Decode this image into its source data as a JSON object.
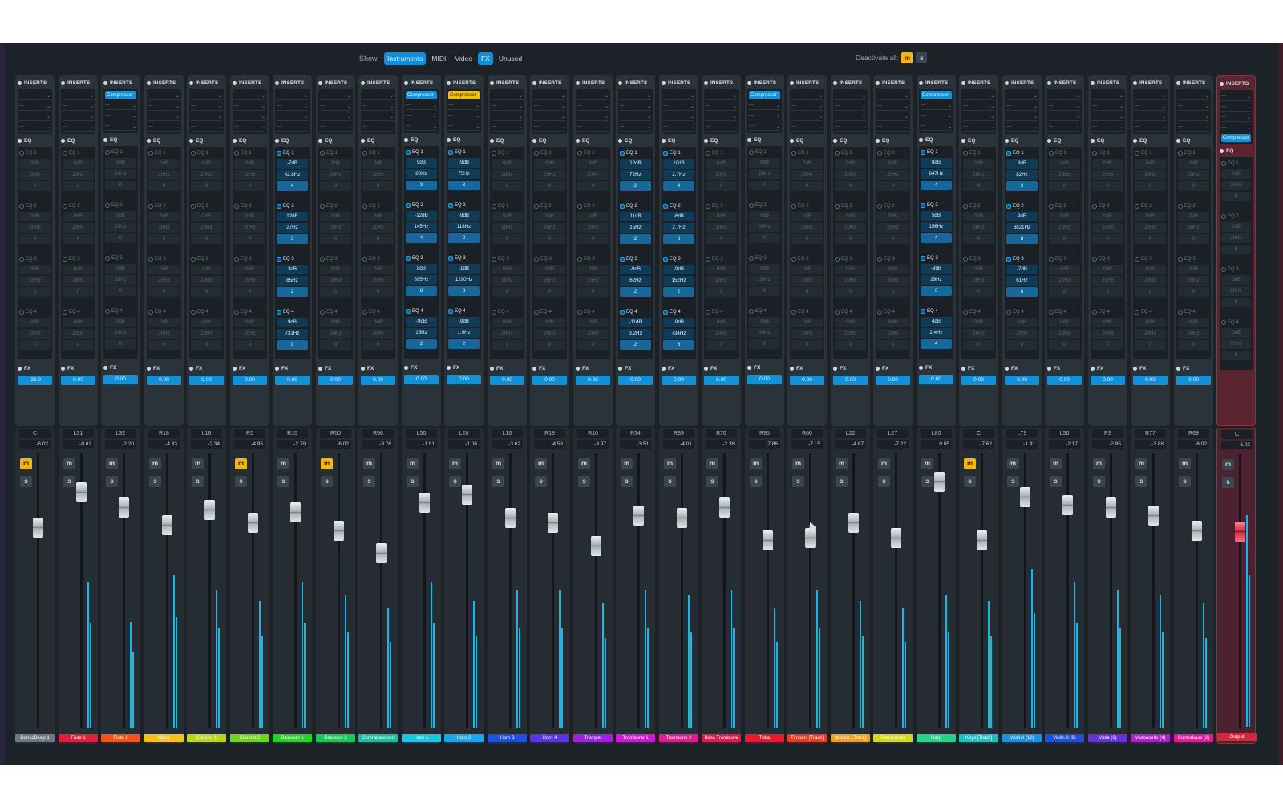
{
  "toolbar": {
    "show_label": "Show:",
    "filters": [
      {
        "label": "Instruments",
        "on": true
      },
      {
        "label": "MIDI",
        "on": false
      },
      {
        "label": "Video",
        "on": false
      },
      {
        "label": "FX",
        "on": true
      },
      {
        "label": "Unused",
        "on": false
      }
    ],
    "deactivate_label": "Deactivate all:",
    "mute_all": "m",
    "solo_all": "s"
  },
  "labels": {
    "inserts": "INSERTS",
    "eq": "EQ",
    "fx": "FX",
    "compressor": "Compressor",
    "empty_slot": "---",
    "mute": "m",
    "solo": "s"
  },
  "colors": {
    "accent": "#1390d6",
    "mute_on": "#f5b800",
    "output": "#8a3442"
  },
  "channels": [
    {
      "name": "DoricoBeep 1",
      "color": "#6e7882",
      "pan": "C",
      "vol": "-6.02",
      "fx": "-26.0",
      "fader": 0.62,
      "meter": 0.0,
      "muted": true,
      "inserts": [],
      "eq": []
    },
    {
      "name": "Flute 1",
      "color": "#e0203a",
      "pan": "L31",
      "vol": "-0.62",
      "fx": "0.00",
      "fader": 0.76,
      "meter": 0.55,
      "muted": false,
      "inserts": [],
      "eq": [
        [
          "0dB",
          "20Hz",
          "0"
        ],
        [
          "0dB",
          "20Hz",
          "0"
        ],
        [
          "0dB",
          "20Hz",
          "0"
        ],
        [
          "0dB",
          "20Hz",
          "0"
        ]
      ]
    },
    {
      "name": "Flute 2",
      "color": "#f0541a",
      "pan": "L32",
      "vol": "-2.20",
      "fx": "0.00",
      "fader": 0.7,
      "meter": 0.4,
      "muted": false,
      "inserts": [
        "Compressor"
      ],
      "eq": [
        [
          "0dB",
          "20Hz",
          "0"
        ],
        [
          "0dB",
          "20Hz",
          "0"
        ],
        [
          "0dB",
          "20Hz",
          "0"
        ],
        [
          "0dB",
          "20Hz",
          "0"
        ]
      ]
    },
    {
      "name": "Oboe",
      "color": "#f5c21a",
      "pan": "R18",
      "vol": "-4.33",
      "fx": "0.00",
      "fader": 0.63,
      "meter": 0.58,
      "muted": false,
      "inserts": [],
      "eq": []
    },
    {
      "name": "Clarinet 1",
      "color": "#b8d61a",
      "pan": "L16",
      "vol": "-2.34",
      "fx": "0.00",
      "fader": 0.69,
      "meter": 0.52,
      "muted": false,
      "inserts": [],
      "eq": []
    },
    {
      "name": "Clarinet 2",
      "color": "#6cd41a",
      "pan": "R5",
      "vol": "-4.95",
      "fx": "0.00",
      "fader": 0.64,
      "meter": 0.48,
      "muted": true,
      "inserts": [],
      "eq": []
    },
    {
      "name": "Bassoon 1",
      "color": "#2ad02a",
      "pan": "R15",
      "vol": "-2.79",
      "fx": "0.00",
      "fader": 0.68,
      "meter": 0.55,
      "muted": false,
      "inserts": [],
      "eq": [
        [
          "-7dB",
          "42.8Hz",
          "4"
        ],
        [
          "12dB",
          "27Hz",
          "3"
        ],
        [
          "3dB",
          "85Hz",
          "2"
        ],
        [
          "9dB",
          "731Hz",
          "9"
        ]
      ]
    },
    {
      "name": "Bassoon 2",
      "color": "#1ac85a",
      "pan": "R50",
      "vol": "-6.02",
      "fx": "0.00",
      "fader": 0.61,
      "meter": 0.5,
      "muted": true,
      "inserts": [],
      "eq": []
    },
    {
      "name": "Contrabassoon",
      "color": "#14c0a0",
      "pan": "R56",
      "vol": "-9.76",
      "fx": "0.00",
      "fader": 0.52,
      "meter": 0.45,
      "muted": false,
      "inserts": [],
      "eq": []
    },
    {
      "name": "Horn 1",
      "color": "#16c8e0",
      "pan": "L50",
      "vol": "-1.91",
      "fx": "0.00",
      "fader": 0.72,
      "meter": 0.55,
      "muted": false,
      "inserts": [
        "Compressor"
      ],
      "eq": [
        [
          "9dB",
          "80Hz",
          "3"
        ],
        [
          "-12dB",
          "145Hz",
          "4"
        ],
        [
          "8dB",
          "895Hz",
          "8"
        ],
        [
          "-9dB",
          "15Hz",
          "2"
        ]
      ]
    },
    {
      "name": "Horn 2",
      "color": "#1aa6e8",
      "pan": "L20",
      "vol": "-1.06",
      "fx": "0.00",
      "fader": 0.75,
      "meter": 0.48,
      "muted": false,
      "inserts": [
        "Compressor*"
      ],
      "eq": [
        [
          "-9dB",
          "75Hz",
          "3"
        ],
        [
          "-9dB",
          "118Hz",
          "2"
        ],
        [
          "-1dB",
          "1290Hz",
          "8"
        ],
        [
          "-9dB",
          "1.9Hz",
          "2"
        ]
      ]
    },
    {
      "name": "Horn 3",
      "color": "#2050e0",
      "pan": "L10",
      "vol": "-3.62",
      "fx": "0.00",
      "fader": 0.66,
      "meter": 0.52,
      "muted": false,
      "inserts": [],
      "eq": []
    },
    {
      "name": "Horn 4",
      "color": "#5a34e0",
      "pan": "R18",
      "vol": "-4.58",
      "fx": "0.00",
      "fader": 0.64,
      "meter": 0.52,
      "muted": false,
      "inserts": [],
      "eq": []
    },
    {
      "name": "Trumpet",
      "color": "#9a24e0",
      "pan": "R10",
      "vol": "-8.97",
      "fx": "0.00",
      "fader": 0.55,
      "meter": 0.47,
      "muted": false,
      "inserts": [],
      "eq": []
    },
    {
      "name": "Trombone 1",
      "color": "#d01ad0",
      "pan": "R34",
      "vol": "-3.51",
      "fx": "0.00",
      "fader": 0.67,
      "meter": 0.52,
      "muted": false,
      "inserts": [],
      "eq": [
        [
          "12dB",
          "72Hz",
          "2"
        ],
        [
          "11dB",
          "15Hz",
          "2"
        ],
        [
          "-9dB",
          "62Hz",
          "2"
        ],
        [
          "-11dB",
          "3.2Hz",
          "2"
        ]
      ]
    },
    {
      "name": "Trombone 2",
      "color": "#e01a90",
      "pan": "R39",
      "vol": "-4.01",
      "fx": "0.00",
      "fader": 0.66,
      "meter": 0.5,
      "muted": false,
      "inserts": [],
      "eq": [
        [
          "10dB",
          "2.7Hz",
          "4"
        ],
        [
          "-6dB",
          "2.7Hz",
          "3"
        ],
        [
          "-9dB",
          "152Hz",
          "2"
        ],
        [
          "-9dB",
          "734Hz",
          "3"
        ]
      ]
    },
    {
      "name": "Bass Trombone",
      "color": "#e01a50",
      "pan": "R76",
      "vol": "-2.18",
      "fx": "0.00",
      "fader": 0.7,
      "meter": 0.52,
      "muted": false,
      "inserts": [],
      "eq": []
    },
    {
      "name": "Tuba",
      "color": "#e81a30",
      "pan": "R95",
      "vol": "-7.86",
      "fx": "0.00",
      "fader": 0.57,
      "meter": 0.45,
      "muted": false,
      "inserts": [
        "Compressor"
      ],
      "eq": []
    },
    {
      "name": "Timpani [Track]",
      "color": "#f03a1a",
      "pan": "R60",
      "vol": "-7.15",
      "fx": "0.00",
      "fader": 0.58,
      "meter": 0.52,
      "muted": false,
      "inserts": [],
      "eq": []
    },
    {
      "name": "Glocke...Track]",
      "color": "#f0a01a",
      "pan": "L22",
      "vol": "-4.67",
      "fx": "0.00",
      "fader": 0.64,
      "meter": 0.48,
      "muted": false,
      "inserts": [],
      "eq": []
    },
    {
      "name": "Percussion",
      "color": "#d6d61a",
      "pan": "L27",
      "vol": "-7.22",
      "fx": "0.00",
      "fader": 0.58,
      "meter": 0.45,
      "muted": false,
      "inserts": [],
      "eq": []
    },
    {
      "name": "Harp",
      "color": "#2ad08a",
      "pan": "L80",
      "vol": "0.05",
      "fx": "0.00",
      "fader": 0.8,
      "meter": 0.5,
      "muted": false,
      "inserts": [
        "Compressor"
      ],
      "eq": [
        [
          "8dB",
          "847Hz",
          "4"
        ],
        [
          "5dB",
          "156Hz",
          "4"
        ],
        [
          "-9dB",
          "29Hz",
          "3"
        ],
        [
          "4dB",
          "2.4Hz",
          "4"
        ]
      ]
    },
    {
      "name": "Keys [Track]",
      "color": "#1ac0c0",
      "pan": "C",
      "vol": "-7.62",
      "fx": "0.00",
      "fader": 0.57,
      "meter": 0.48,
      "muted": true,
      "inserts": [],
      "eq": []
    },
    {
      "name": "Violin I (10)",
      "color": "#1a90e0",
      "pan": "L79",
      "vol": "-1.41",
      "fx": "0.00",
      "fader": 0.74,
      "meter": 0.6,
      "muted": false,
      "inserts": [],
      "eq": [
        [
          "8dB",
          "82Hz",
          "3"
        ],
        [
          "9dB",
          "6821Hz",
          "8"
        ],
        [
          "-7dB",
          "61Hz",
          "8"
        ],
        [
          "0dB",
          "20Hz",
          "0"
        ]
      ]
    },
    {
      "name": "Violin II (8)",
      "color": "#2050d8",
      "pan": "L50",
      "vol": "-2.17",
      "fx": "0.00",
      "fader": 0.71,
      "meter": 0.55,
      "muted": false,
      "inserts": [],
      "eq": []
    },
    {
      "name": "Viola (6)",
      "color": "#6a30d8",
      "pan": "R9",
      "vol": "-2.85",
      "fx": "0.00",
      "fader": 0.7,
      "meter": 0.52,
      "muted": false,
      "inserts": [],
      "eq": []
    },
    {
      "name": "Violoncello (4)",
      "color": "#b020c8",
      "pan": "R77",
      "vol": "-3.88",
      "fx": "0.00",
      "fader": 0.67,
      "meter": 0.5,
      "muted": false,
      "inserts": [],
      "eq": []
    },
    {
      "name": "Contrabass (2)",
      "color": "#e01aa0",
      "pan": "R69",
      "vol": "-6.02",
      "fx": "0.00",
      "fader": 0.61,
      "meter": 0.47,
      "muted": false,
      "inserts": [],
      "eq": []
    },
    {
      "name": "Output",
      "color": "#d12840",
      "pan": "C",
      "vol": "-6.02",
      "fx": "",
      "fader": 0.61,
      "meter": 0.8,
      "muted": false,
      "inserts": [
        "Compressor"
      ],
      "eq": [],
      "output": true
    }
  ]
}
